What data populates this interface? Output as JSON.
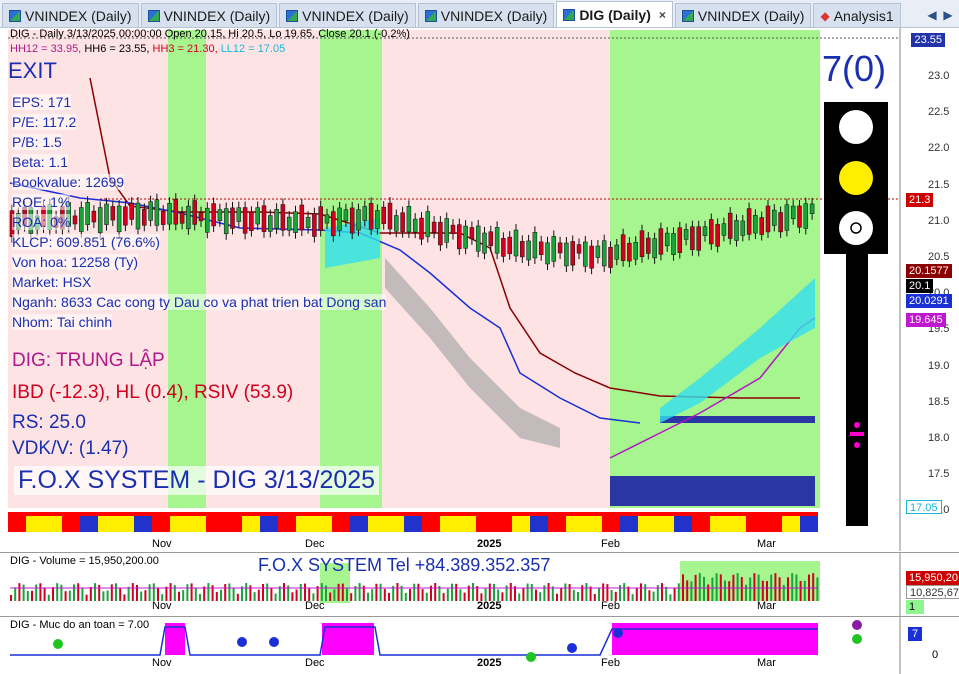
{
  "tabs": [
    {
      "label": "VNINDEX (Daily)",
      "active": false
    },
    {
      "label": "VNINDEX (Daily)",
      "active": false
    },
    {
      "label": "VNINDEX (Daily)",
      "active": false
    },
    {
      "label": "VNINDEX (Daily)",
      "active": false
    },
    {
      "label": "DIG (Daily)",
      "active": true
    },
    {
      "label": "VNINDEX (Daily)",
      "active": false
    },
    {
      "label": "Analysis1",
      "active": false
    }
  ],
  "tab_close": "×",
  "tab_nav": {
    "prev": "◀",
    "next": "▶"
  },
  "main_chart": {
    "header_line1": "DIG - Daily 3/13/2025 00:00:00 Open 20.15, Hi 20.5, Lo 19.65, Close 20.1 (-0.2%)",
    "header_line2": {
      "hh12": "HH12 = 33.95,",
      "hh6": "HH6 = 23.55,",
      "hh3": "HH3 = 21.30,",
      "ll12": "LL12 = 17.05"
    },
    "signal": "EXIT",
    "fundamentals": [
      "EPS: 171",
      "P/E: 117.2",
      "P/B: 1.5",
      "Beta: 1.1",
      "Bookvalue: 12699",
      "ROE: 1%",
      "ROA: 0%",
      "KLCP: 609.851 (76.6%)",
      "Von hoa: 12258 (Ty)",
      "Market: HSX",
      "Nganh: 8633 Cac cong ty Dau co va phat trien bat Dong san",
      "Nhom: Tai chinh"
    ],
    "rating": "DIG: TRUNG LẬP",
    "indicators": "IBD (-12.3), HL (0.4), RSIV (53.9)",
    "rs": "RS: 25.0",
    "vdkv": "VDK/V:  (1.47)",
    "system_title": "F.O.X SYSTEM - DIG 3/13/2025",
    "score": "7(0)",
    "month_labels": [
      "Nov",
      "Dec",
      "2025",
      "Feb",
      "Mar"
    ],
    "y_axis": [
      "23.0",
      "22.5",
      "22.0",
      "21.5",
      "21.0",
      "20.5",
      "20.0",
      "19.5",
      "19.0",
      "18.5",
      "18.0",
      "17.5",
      "17.0"
    ],
    "price_badges": {
      "hh6": "23.55",
      "hh3": "21.3",
      "upper": "20.1577",
      "close": "20.1",
      "mid": "20.0291",
      "lower": "19.645",
      "ll12": "17.05"
    },
    "colors": {
      "up": "#1aa33a",
      "down": "#d1001f",
      "green_zone": "#a6f58f",
      "pink_zone": "#fde3e3"
    }
  },
  "volume_pane": {
    "header": "DIG - Volume = 15,950,200.00",
    "banner": "F.O.X SYSTEM Tel +84.389.352.357",
    "badges": {
      "vol": "15,950,20",
      "ma": "10,825,67",
      "flag": "1"
    }
  },
  "safety_pane": {
    "header": "DIG - Muc do an toan = 7.00",
    "level": "7",
    "axis_zero": "0"
  }
}
